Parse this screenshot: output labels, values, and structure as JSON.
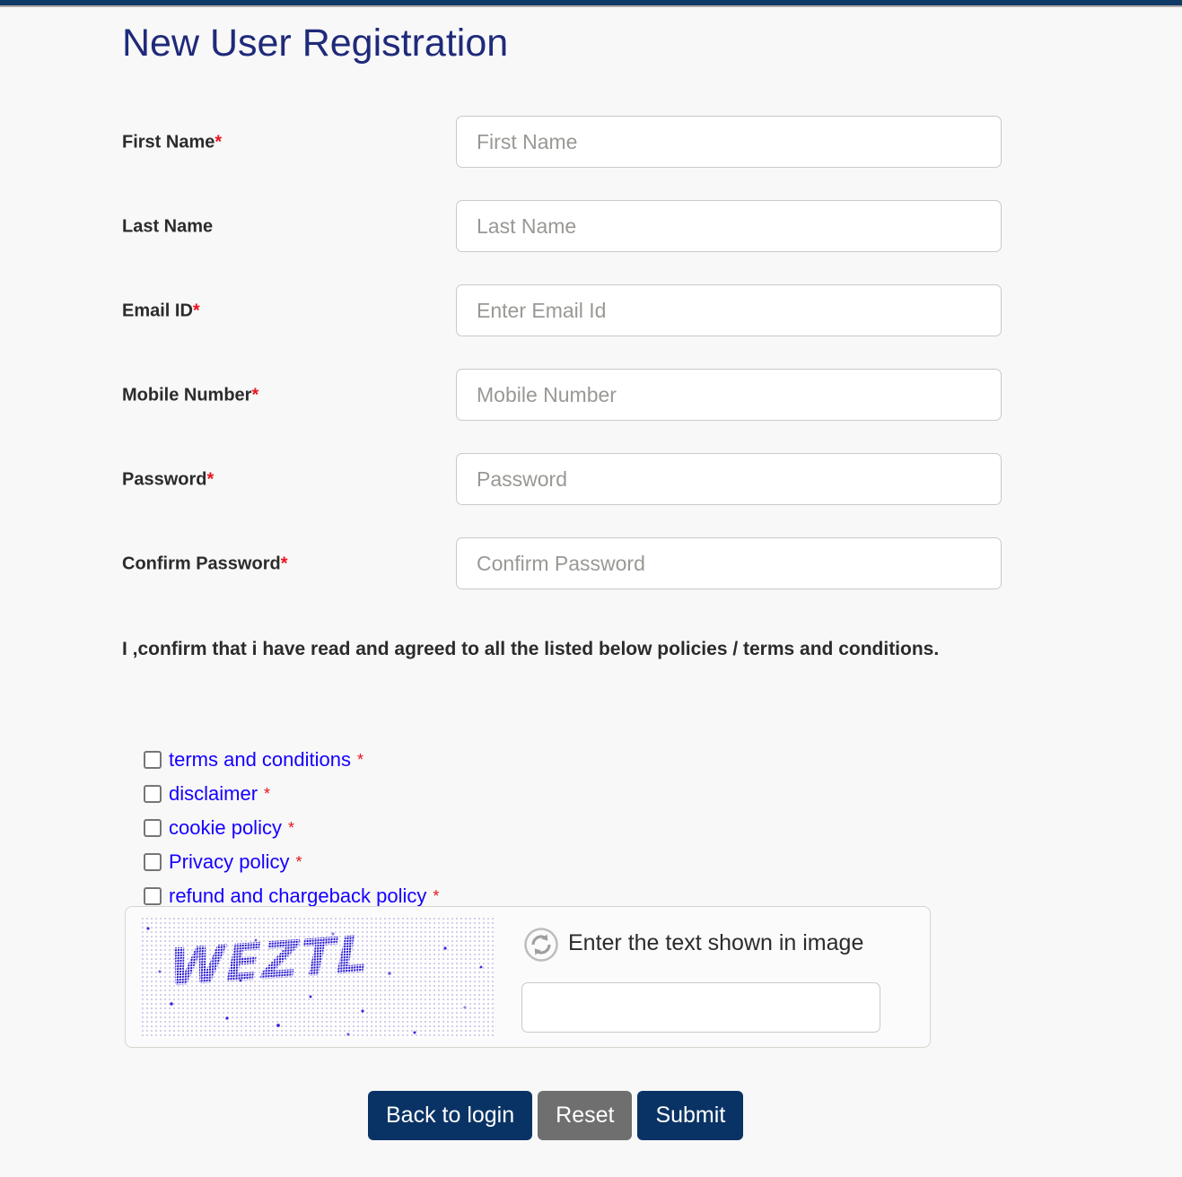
{
  "page": {
    "title": "New User Registration",
    "top_bar_color": "#103a66",
    "background_color": "#f8f8f8",
    "title_color": "#1f2a7a",
    "required_marker": "*",
    "required_color": "#e8141e"
  },
  "form": {
    "fields": [
      {
        "label": "First Name",
        "required": true,
        "placeholder": "First Name",
        "value": ""
      },
      {
        "label": "Last Name",
        "required": false,
        "placeholder": "Last Name",
        "value": ""
      },
      {
        "label": "Email ID",
        "required": true,
        "placeholder": "Enter Email Id",
        "value": ""
      },
      {
        "label": "Mobile Number",
        "required": true,
        "placeholder": "Mobile Number",
        "value": ""
      },
      {
        "label": "Password",
        "required": true,
        "placeholder": "Password",
        "value": ""
      },
      {
        "label": "Confirm Password",
        "required": true,
        "placeholder": "Confirm Password",
        "value": ""
      }
    ]
  },
  "consent": {
    "text": "I ,confirm that i have read and agreed to all the listed below policies / terms and conditions.",
    "policies": [
      {
        "label": "terms and conditions",
        "required": true,
        "checked": false
      },
      {
        "label": "disclaimer",
        "required": true,
        "checked": false
      },
      {
        "label": "cookie policy",
        "required": true,
        "checked": false
      },
      {
        "label": "Privacy policy",
        "required": true,
        "checked": false
      },
      {
        "label": "refund and chargeback policy",
        "required": true,
        "checked": false
      }
    ],
    "link_color": "#1500ff",
    "star": "*"
  },
  "captcha": {
    "image_text": "WEZTL",
    "refresh_icon": "refresh-icon",
    "label": "Enter the text shown in image",
    "input_value": "",
    "input_placeholder": ""
  },
  "buttons": {
    "back_to_login": "Back to login",
    "reset": "Reset",
    "submit": "Submit",
    "primary_color": "#0a3365",
    "secondary_color": "#6f6f6f"
  }
}
